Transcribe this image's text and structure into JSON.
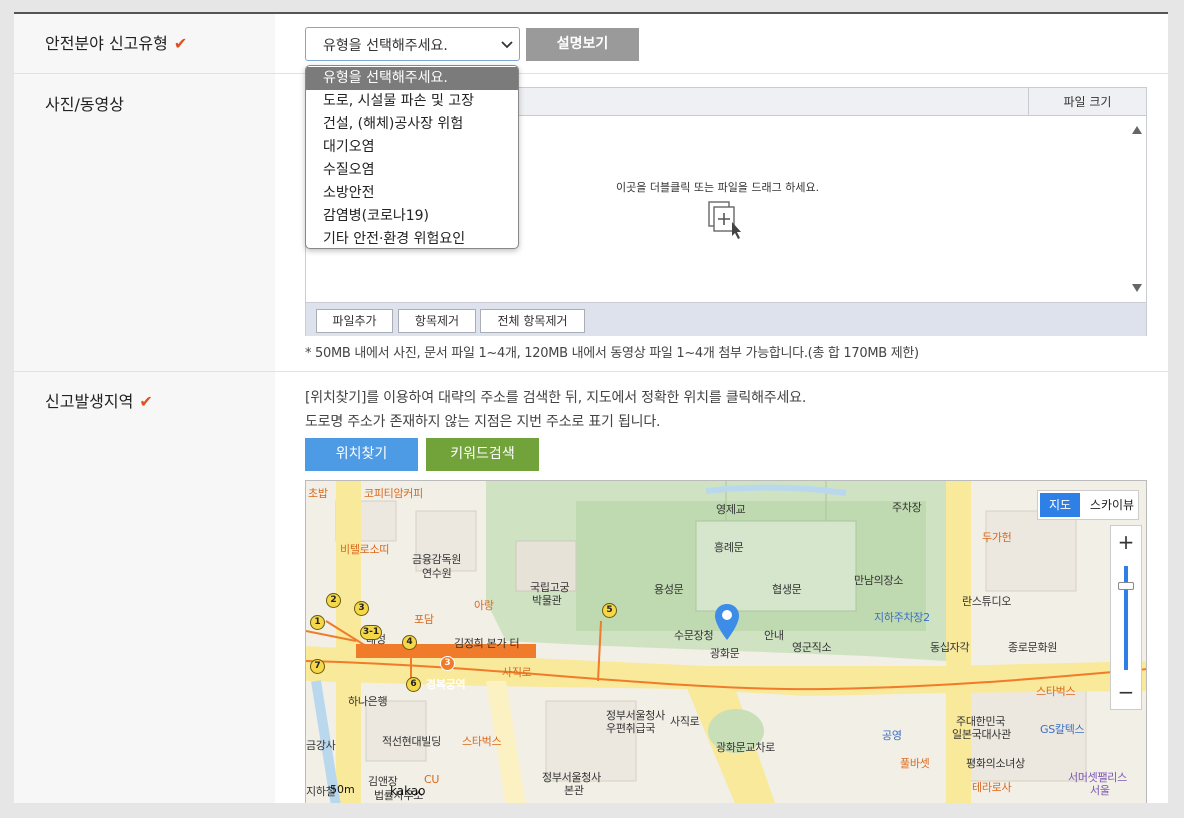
{
  "rows": {
    "type_label": "안전분야 신고유형",
    "media_label": "사진/동영상",
    "location_label": "신고발생지역",
    "check_mark": "✔"
  },
  "type_select": {
    "value": "유형을 선택해주세요.",
    "explain_button": "설명보기",
    "options": [
      "유형을 선택해주세요.",
      "도로, 시설물 파손 및 고장",
      "건설, (해체)공사장 위험",
      "대기오염",
      "수질오염",
      "소방안전",
      "감염병(코로나19)",
      "기타 안전·환경 위험요인"
    ]
  },
  "upload": {
    "col_filesize": "파일 크기",
    "drop_hint": "이곳을 더블클릭 또는 파일을 드래그 하세요.",
    "add_file": "파일추가",
    "remove_item": "항목제거",
    "remove_all": "전체 항목제거",
    "note": "* 50MB 내에서 사진, 문서 파일 1~4개, 120MB 내에서 동영상 파일 1~4개 첨부 가능합니다.(총 합 170MB 제한)"
  },
  "location": {
    "instruction1": "[위치찾기]를 이용하여 대략의 주소를 검색한 뒤, 지도에서 정확한 위치를 클릭해주세요.",
    "instruction2": "도로명 주소가 존재하지 않는 지점은 지번 주소로 표기 됩니다.",
    "find_button": "위치찾기",
    "keyword_button": "키워드검색"
  },
  "map": {
    "view_map": "지도",
    "view_sky": "스카이뷰",
    "zoom_in": "+",
    "zoom_out": "−",
    "scale": "50m",
    "brand": "kakao",
    "labels": [
      "초밥",
      "코피티암커피",
      "비텔로소띠",
      "금융감독원",
      "연수원",
      "아랑",
      "포담",
      "국립고궁",
      "박물관",
      "김정희 본가 터",
      "영제교",
      "흥례문",
      "용성문",
      "협생문",
      "수문장청",
      "안내",
      "광화문",
      "영군직소",
      "주차장",
      "만남의장소",
      "지하주차장2",
      "란스튜디오",
      "동십자각",
      "종로문화원",
      "두가헌",
      "스타벅스",
      "주대한민국",
      "일본국대사관",
      "GS칼텍스",
      "하나은행",
      "정부서울청사",
      "우편취급국",
      "적선현대빌딩",
      "스타벅스",
      "CU",
      "정부서울청사",
      "본관",
      "광화문교차로",
      "사직로",
      "경복궁역",
      "공영",
      "풀바셋",
      "평화의소녀상",
      "테라로사",
      "서머셋팰리스",
      "서울",
      "금강사",
      "김앤장",
      "법률사무소",
      "사직로",
      "지하철",
      "대성"
    ],
    "markers": [
      "1",
      "2",
      "3",
      "3-1",
      "4",
      "5",
      "6",
      "7",
      "3"
    ]
  }
}
